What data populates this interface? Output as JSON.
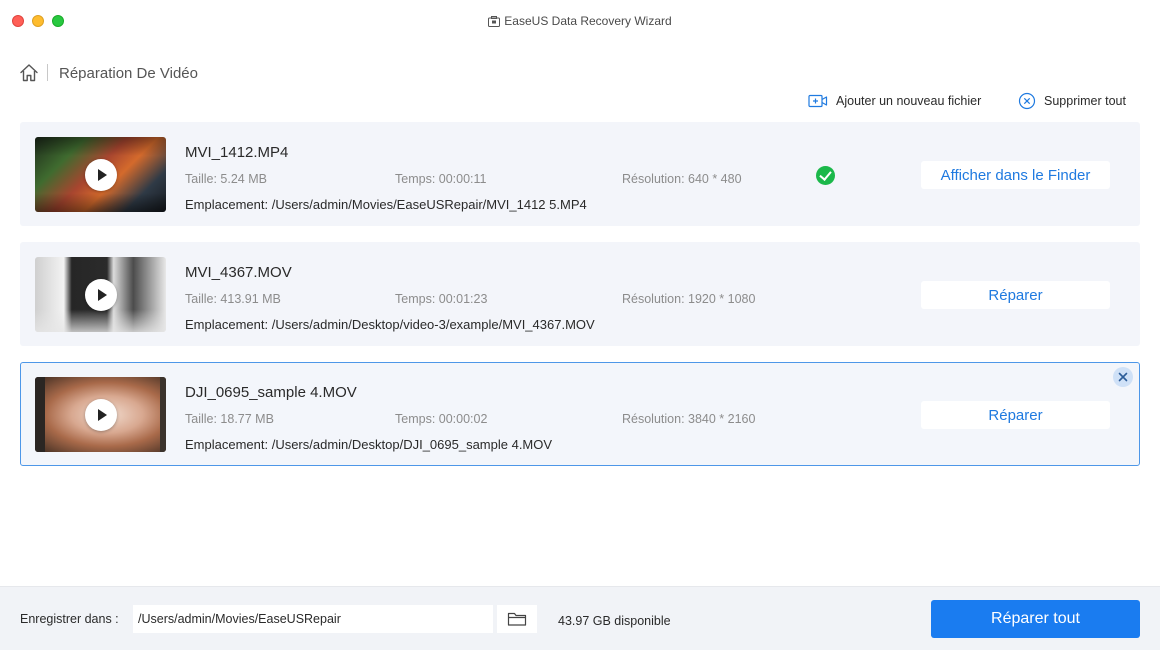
{
  "window": {
    "title": "EaseUS Data Recovery Wizard"
  },
  "breadcrumb": {
    "title": "Réparation De Vidéo"
  },
  "toolbar": {
    "add_label": "Ajouter un nouveau fichier",
    "delete_label": "Supprimer tout"
  },
  "files": [
    {
      "name": "MVI_1412.MP4",
      "size": "Taille: 5.24 MB",
      "duration": "Temps: 00:00:11",
      "resolution": "Résolution: 640 * 480",
      "location": "Emplacement: /Users/admin/Movies/EaseUSRepair/MVI_1412 5.MP4",
      "status": "repaired",
      "action_label": "Afficher dans le Finder"
    },
    {
      "name": "MVI_4367.MOV",
      "size": "Taille: 413.91 MB",
      "duration": "Temps: 00:01:23",
      "resolution": "Résolution: 1920 * 1080",
      "location": "Emplacement: /Users/admin/Desktop/video-3/example/MVI_4367.MOV",
      "action_label": "Réparer"
    },
    {
      "name": "DJI_0695_sample 4.MOV",
      "size": "Taille: 18.77 MB",
      "duration": "Temps: 00:00:02",
      "resolution": "Résolution: 3840 * 2160",
      "location": "Emplacement: /Users/admin/Desktop/DJI_0695_sample 4.MOV",
      "action_label": "Réparer",
      "selected": true
    }
  ],
  "footer": {
    "save_label": "Enregistrer dans :",
    "save_path": "/Users/admin/Movies/EaseUSRepair",
    "space_available": "43.97 GB disponible",
    "repair_all_label": "Réparer tout"
  },
  "colors": {
    "accent": "#1a7cf0",
    "success": "#1bb84a",
    "selected_border": "#4d97e8"
  }
}
